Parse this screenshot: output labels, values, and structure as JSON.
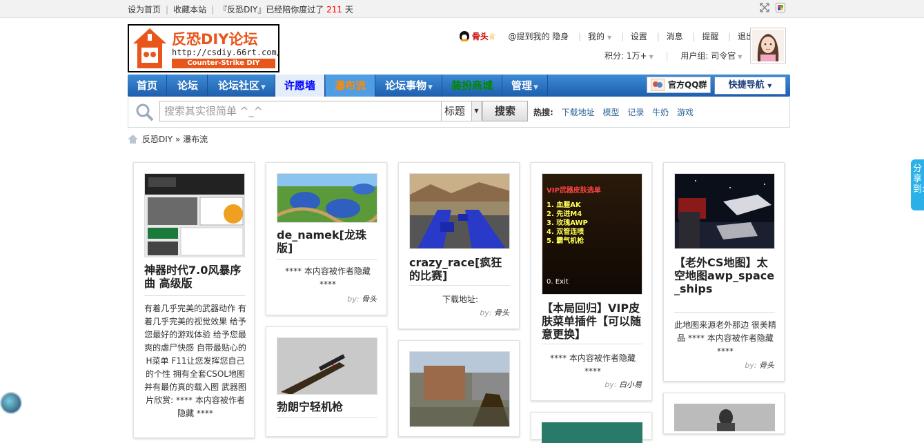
{
  "topbar": {
    "set_home": "设为首页",
    "bookmark": "收藏本站",
    "stay_prefix": "『反恐DIY』已经陪你度过了",
    "days": "211",
    "stay_suffix": "天"
  },
  "logo": {
    "title": "反恐DIY论坛",
    "url": "http://csdiy.66rt.com/",
    "sub": "Counter-Strike DIY"
  },
  "user": {
    "name": "骨头",
    "mention": "@提到我的",
    "invisible": "隐身",
    "mine": "我的",
    "settings": "设置",
    "messages": "消息",
    "reminder": "提醒",
    "logout": "退出",
    "points": "积分: 1万+",
    "group": "用户组: 司令官"
  },
  "nav": {
    "items": [
      "首页",
      "论坛",
      "论坛社区",
      "许愿墙",
      "瀑布流",
      "论坛事物",
      "装扮商城",
      "管理"
    ],
    "qq_group": "官方QQ群",
    "quick_nav": "快捷导航"
  },
  "search": {
    "placeholder": "搜索其实很简单 ^_^",
    "type": "标题",
    "button": "搜索",
    "hot_label": "热搜:",
    "hot": [
      "下载地址",
      "模型",
      "记录",
      "牛奶",
      "游戏"
    ]
  },
  "breadcrumb": {
    "home": "反恐DIY",
    "sep": "»",
    "current": "瀑布流"
  },
  "cards": [
    {
      "title": "神器时代7.0风暴序曲 高级版",
      "desc": "有着几乎完美的武器动作 有着几乎完美的视觉效果 给予您最好的游戏体验 给予您最爽的虐尸快感 自带最贴心的H菜单 F11让您发挥您自己的个性 拥有全套CSOL地图 并有最仿真的载入图 武器图片欣赏: **** 本内容被作者隐藏 ****",
      "by": "by:",
      "author": "骨头"
    },
    {
      "title": "de_namek[龙珠版]",
      "desc": "**** 本内容被作者隐藏 ****",
      "by": "by:",
      "author": "骨头"
    },
    {
      "title": "勃朗宁轻机枪",
      "desc": "",
      "by": "",
      "author": ""
    },
    {
      "title": "crazy_race[疯狂的比赛]",
      "desc": "下载地址:",
      "by": "by:",
      "author": "骨头"
    },
    {
      "title": "",
      "desc": "",
      "by": "",
      "author": ""
    },
    {
      "title": "【本局回归】VIP皮肤菜单插件【可以随意更换】",
      "desc": "**** 本内容被作者隐藏 ****",
      "by": "by:",
      "author": "白小易"
    },
    {
      "title": "【老外CS地图】太空地图awp_space_ships",
      "desc": "此地图来源老外那边 很美精品 **** 本内容被作者隐藏 ****",
      "by": "by:",
      "author": "骨头"
    }
  ],
  "vip_menu": {
    "header": "VIP武器皮肤选单",
    "items": [
      "1. 血腥AK",
      "2. 先进M4",
      "3. 玫瑰AWP",
      "4. 双管连喷",
      "5. 霸气机枪"
    ],
    "exit": "0. Exit"
  },
  "share": "分享到:"
}
